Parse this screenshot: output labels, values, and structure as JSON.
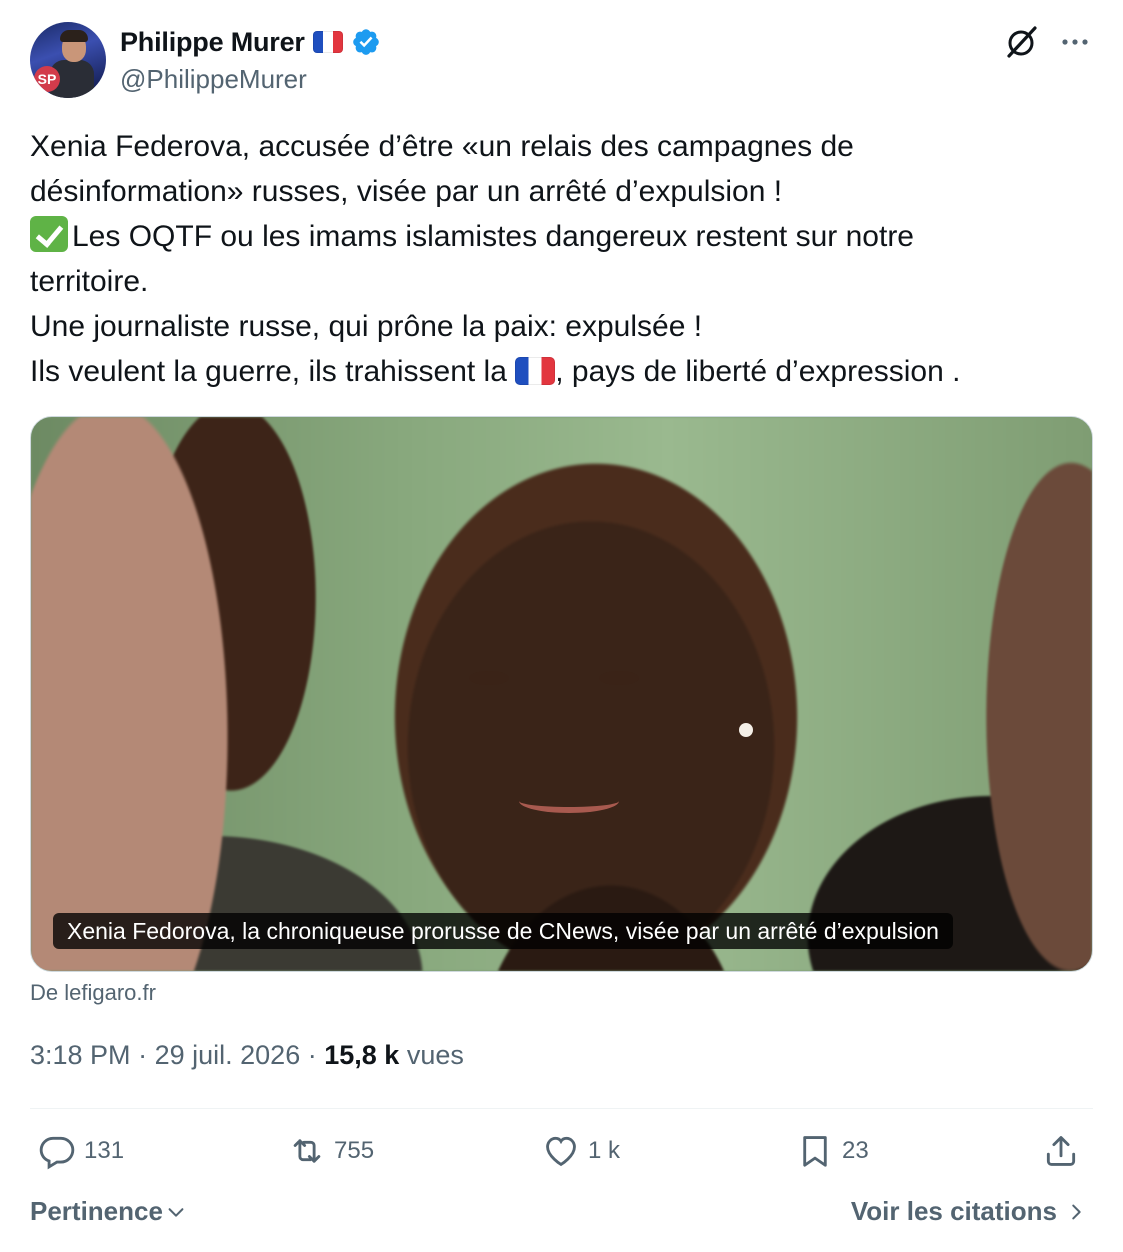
{
  "author": {
    "display_name": "Philippe Murer",
    "handle": "@PhilippeMurer",
    "verified": true,
    "avatar_badge": "SP"
  },
  "tweet": {
    "lines": [
      "Xenia Federova, accusée d’être «un relais des campagnes de",
      "désinformation» russes, visée par un arrêté d’expulsion !",
      "Les OQTF ou les imams islamistes dangereux restent sur notre",
      "territoire.",
      "Une journaliste russe, qui prône la paix: expulsée !",
      "Ils veulent la guerre, ils trahissent la",
      ", pays de liberté d’expression ."
    ]
  },
  "card": {
    "caption": "Xenia Fedorova, la chroniqueuse prorusse de CNews, visée par un arrêté d’expulsion",
    "source": "De lefigaro.fr"
  },
  "meta": {
    "time": "3:18 PM",
    "separator": "·",
    "date": "29 juil. 2026",
    "views_count": "15,8 k",
    "views_label": "vues"
  },
  "actions": {
    "replies": "131",
    "reposts": "755",
    "likes": "1 k",
    "bookmarks": "23"
  },
  "footer": {
    "sort_label": "Pertinence",
    "quotes_label": "Voir les citations"
  },
  "colors": {
    "text": "#0f1419",
    "secondary": "#536471",
    "verified": "#1d9bf0",
    "border": "#cfd9de"
  },
  "icons": {
    "verified": "verified-badge-icon",
    "grok": "grok-icon",
    "more": "more-dots-icon",
    "reply": "reply-icon",
    "repost": "repost-icon",
    "like": "heart-icon",
    "bookmark": "bookmark-icon",
    "share": "share-icon",
    "chevron_down": "chevron-down-icon",
    "chevron_right": "chevron-right-icon"
  }
}
